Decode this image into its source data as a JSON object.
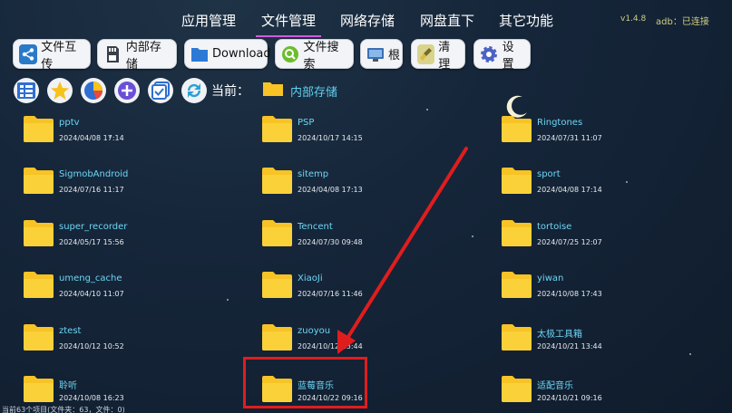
{
  "nav": {
    "tabs": [
      "应用管理",
      "文件管理",
      "网络存储",
      "网盘直下",
      "其它功能"
    ],
    "active_index": 1,
    "version": "v1.4.8",
    "adb": "adb：已连接"
  },
  "toolbar": {
    "buttons": [
      {
        "label": "文件互传",
        "icon": "share-icon"
      },
      {
        "label": "内部存储",
        "icon": "sd-card-icon"
      },
      {
        "label": "Download",
        "icon": "folder-icon"
      },
      {
        "label": "文件搜索",
        "icon": "search-icon"
      },
      {
        "label": "根",
        "icon": "monitor-icon"
      },
      {
        "label": "清理",
        "icon": "broom-icon"
      },
      {
        "label": "设置",
        "icon": "gear-icon"
      }
    ]
  },
  "iconrow": {
    "icons": [
      "list-view-icon",
      "favorite-star-icon",
      "pie-chart-icon",
      "add-icon",
      "multi-select-icon",
      "refresh-icon"
    ],
    "current_label": "当前：",
    "current_path": "内部存储"
  },
  "folders": [
    {
      "name": "pptv",
      "date": "2024/04/08 17:14"
    },
    {
      "name": "PSP",
      "date": "2024/10/17 14:15"
    },
    {
      "name": "Ringtones",
      "date": "2024/07/31 11:07"
    },
    {
      "name": "SigmobAndroid",
      "date": "2024/07/16 11:17"
    },
    {
      "name": "sitemp",
      "date": "2024/04/08 17:13"
    },
    {
      "name": "sport",
      "date": "2024/04/08 17:14"
    },
    {
      "name": "super_recorder",
      "date": "2024/05/17 15:56"
    },
    {
      "name": "Tencent",
      "date": "2024/07/30 09:48"
    },
    {
      "name": "tortoise",
      "date": "2024/07/25 12:07"
    },
    {
      "name": "umeng_cache",
      "date": "2024/04/10 11:07"
    },
    {
      "name": "XiaoJi",
      "date": "2024/07/16 11:46"
    },
    {
      "name": "yiwan",
      "date": "2024/10/08 17:43"
    },
    {
      "name": "ztest",
      "date": "2024/10/12 10:52"
    },
    {
      "name": "zuoyou",
      "date": "2024/10/12 13:44"
    },
    {
      "name": "太极工具箱",
      "date": "2024/10/21 13:44"
    },
    {
      "name": "聆听",
      "date": "2024/10/08 16:23"
    },
    {
      "name": "蓝莓音乐",
      "date": "2024/10/22 09:16"
    },
    {
      "name": "适配音乐",
      "date": "2024/10/21 09:16"
    }
  ],
  "status": "当前63个项目(文件夹：63，文件：0)",
  "colors": {
    "accent_underline": "#d15be0",
    "folder_name": "#6dd6f5",
    "highlight_box": "#e01d1d",
    "arrow": "#e01d1d",
    "folder_yellow": "#f7c325"
  }
}
